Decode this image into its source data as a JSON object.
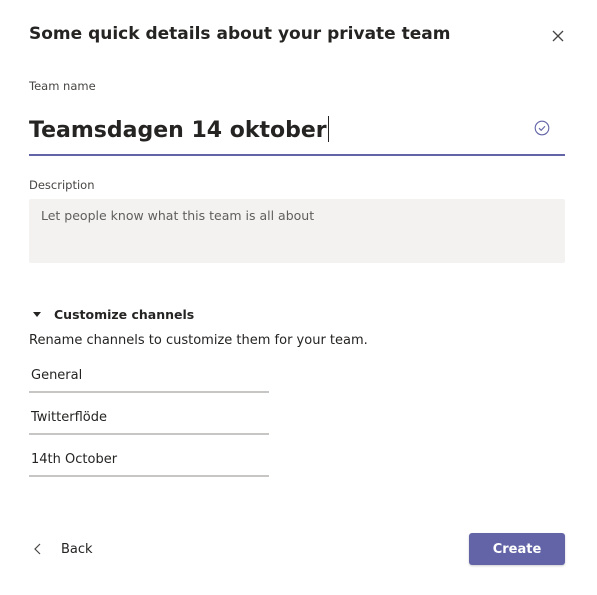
{
  "dialog": {
    "title": "Some quick details about your private team",
    "close_icon": "close-icon"
  },
  "team_name": {
    "label": "Team name",
    "value": "Teamsdagen 14 oktober",
    "status_icon": "check-circle-icon"
  },
  "description": {
    "label": "Description",
    "placeholder": "Let people know what this team is all about"
  },
  "customize": {
    "label": "Customize channels",
    "hint": "Rename channels to customize them for your team.",
    "channels": [
      "General",
      "Twitterflöde",
      "14th October"
    ]
  },
  "footer": {
    "back_label": "Back",
    "create_label": "Create"
  },
  "colors": {
    "accent": "#6264a7",
    "field_background": "#f3f2f1",
    "text": "#252423"
  }
}
